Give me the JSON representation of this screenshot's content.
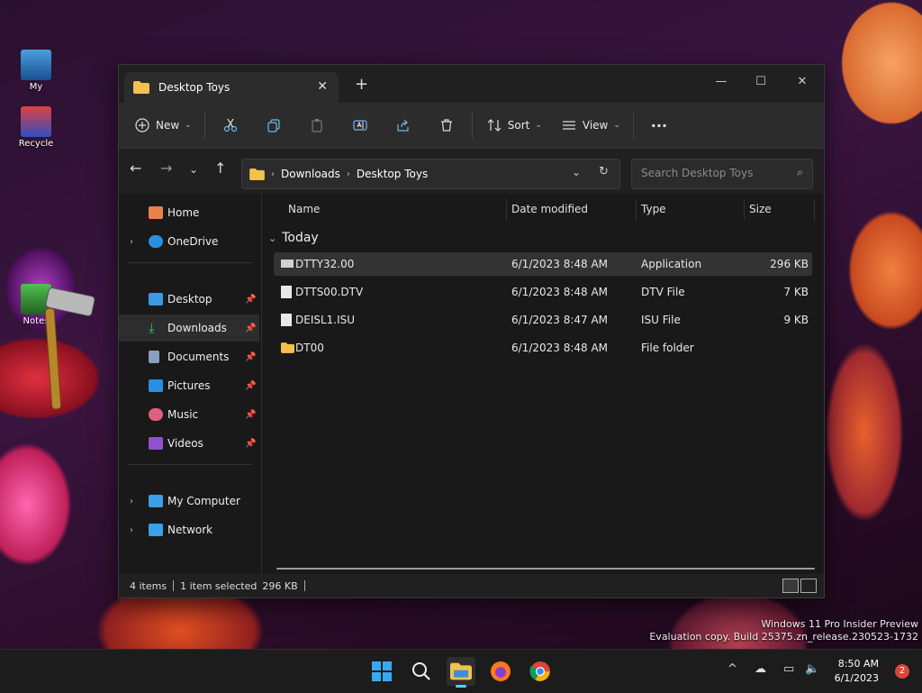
{
  "desktop": {
    "icons": [
      {
        "label": "My"
      },
      {
        "label": "Recycle"
      },
      {
        "label": "Notes"
      }
    ],
    "watermark": {
      "line1": "Windows 11 Pro Insider Preview",
      "line2": "Evaluation copy. Build 25375.zn_release.230523-1732"
    }
  },
  "window": {
    "tab_title": "Desktop Toys",
    "new_tab": "+",
    "controls": {
      "minimize": "—",
      "maximize": "☐",
      "close": "✕"
    }
  },
  "toolbar": {
    "new_label": "New",
    "sort_label": "Sort",
    "view_label": "View",
    "more_label": "···"
  },
  "address": {
    "crumbs": [
      "Downloads",
      "Desktop Toys"
    ],
    "search_placeholder": "Search Desktop Toys"
  },
  "sidebar": {
    "items": [
      {
        "label": "Home"
      },
      {
        "label": "OneDrive"
      },
      {
        "label": "Desktop"
      },
      {
        "label": "Downloads"
      },
      {
        "label": "Documents"
      },
      {
        "label": "Pictures"
      },
      {
        "label": "Music"
      },
      {
        "label": "Videos"
      },
      {
        "label": "My Computer"
      },
      {
        "label": "Network"
      }
    ]
  },
  "columns": {
    "name": "Name",
    "date": "Date modified",
    "type": "Type",
    "size": "Size"
  },
  "group": {
    "label": "Today"
  },
  "files": [
    {
      "name": "DTTY32.00",
      "date": "6/1/2023 8:48 AM",
      "type": "Application",
      "size": "296 KB"
    },
    {
      "name": "DTTS00.DTV",
      "date": "6/1/2023 8:48 AM",
      "type": "DTV File",
      "size": "7 KB"
    },
    {
      "name": "DEISL1.ISU",
      "date": "6/1/2023 8:47 AM",
      "type": "ISU File",
      "size": "9 KB"
    },
    {
      "name": "DT00",
      "date": "6/1/2023 8:48 AM",
      "type": "File folder",
      "size": ""
    }
  ],
  "status": {
    "items": "4 items",
    "selected": "1 item selected",
    "size": "296 KB"
  },
  "taskbar": {
    "time": "8:50 AM",
    "date": "6/1/2023",
    "notifications": "2"
  },
  "colors": {
    "accent": "#60cdff",
    "folder": "#f2c14e",
    "window_bg": "#191919",
    "toolbar_bg": "#2c2c2c"
  }
}
